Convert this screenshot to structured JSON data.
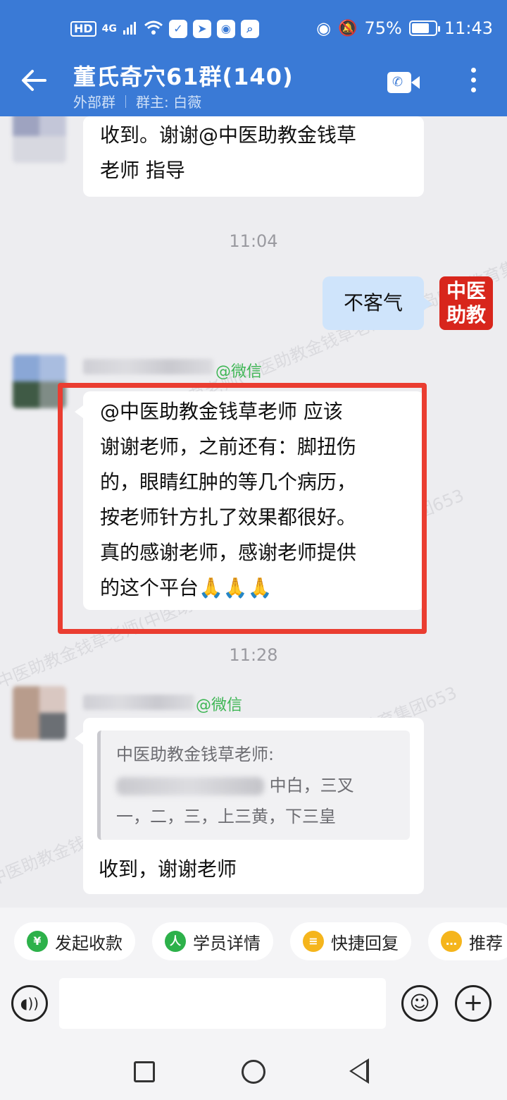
{
  "status": {
    "hd": "HD",
    "signal": "4G",
    "battery_percent": "75%",
    "battery_level": 0.75,
    "time": "11:43"
  },
  "header": {
    "title": "董氏奇穴61群(140)",
    "tag": "外部群",
    "owner": "群主: 白薇"
  },
  "messages": {
    "m1_text_line1": "收到。谢谢@中医助教金钱草",
    "m1_text_line2": "老师 指导",
    "time1": "11:04",
    "m2_text": "不客气",
    "my_avatar_line1": "中医",
    "my_avatar_line2": "助教",
    "m3_tag": "@微信",
    "m3_lines": [
      "@中医助教金钱草老师 应该",
      "谢谢老师，之前还有：脚扭伤",
      "的，眼睛红肿的等几个病历，",
      "按老师针方扎了效果都很好。",
      "真的感谢老师，感谢老师提供",
      "的这个平台🙏🙏🙏"
    ],
    "time2": "11:28",
    "m4_tag": "@微信",
    "m4_quote_author": "中医助教金钱草老师:",
    "m4_quote_line2_suffix": "中白，三叉",
    "m4_quote_line3": "一，二，三，上三黄，下三皇",
    "m4_text": "收到，谢谢老师"
  },
  "watermark": "中医助教金钱草老师(中医助教金钱草老师)@青岛中域教育集团653",
  "quick_actions": [
    {
      "label": "发起收款",
      "icon": "¥",
      "color": "#2db14a"
    },
    {
      "label": "学员详情",
      "icon": "人",
      "color": "#2db14a"
    },
    {
      "label": "快捷回复",
      "icon": "≡",
      "color": "#f5b51c"
    },
    {
      "label": "推荐",
      "icon": "…",
      "color": "#f5b51c"
    }
  ]
}
